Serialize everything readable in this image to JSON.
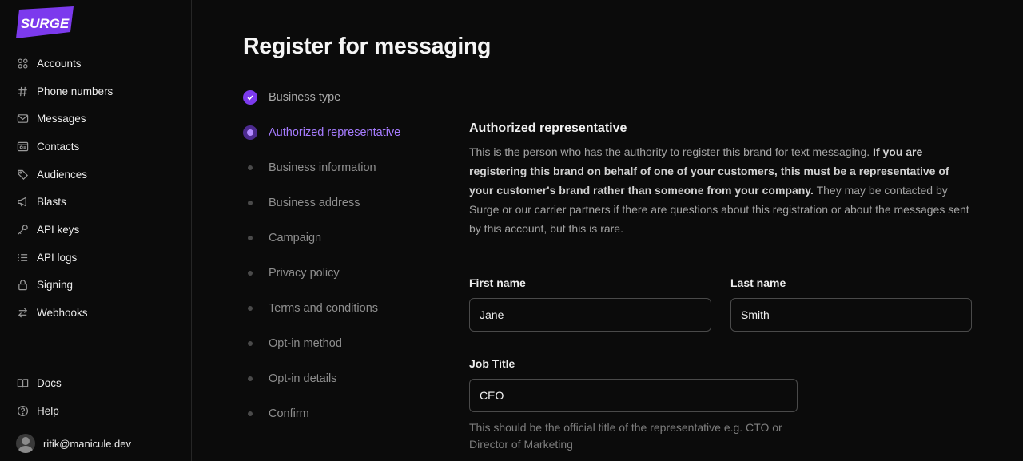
{
  "brand": {
    "name": "SURGE",
    "color": "#7c3aed"
  },
  "sidebar": {
    "items": [
      {
        "label": "Accounts",
        "icon": "accounts-icon"
      },
      {
        "label": "Phone numbers",
        "icon": "hash-icon"
      },
      {
        "label": "Messages",
        "icon": "mail-icon"
      },
      {
        "label": "Contacts",
        "icon": "contact-card-icon"
      },
      {
        "label": "Audiences",
        "icon": "tag-icon"
      },
      {
        "label": "Blasts",
        "icon": "megaphone-icon"
      },
      {
        "label": "API keys",
        "icon": "key-icon"
      },
      {
        "label": "API logs",
        "icon": "list-icon"
      },
      {
        "label": "Signing",
        "icon": "lock-icon"
      },
      {
        "label": "Webhooks",
        "icon": "arrows-icon"
      }
    ],
    "bottom": [
      {
        "label": "Docs",
        "icon": "book-icon"
      },
      {
        "label": "Help",
        "icon": "help-icon"
      }
    ],
    "user": {
      "email": "ritik@manicule.dev"
    }
  },
  "page": {
    "title": "Register for messaging"
  },
  "steps": [
    {
      "label": "Business type",
      "state": "completed"
    },
    {
      "label": "Authorized representative",
      "state": "current"
    },
    {
      "label": "Business information",
      "state": "pending"
    },
    {
      "label": "Business address",
      "state": "pending"
    },
    {
      "label": "Campaign",
      "state": "pending"
    },
    {
      "label": "Privacy policy",
      "state": "pending"
    },
    {
      "label": "Terms and conditions",
      "state": "pending"
    },
    {
      "label": "Opt-in method",
      "state": "pending"
    },
    {
      "label": "Opt-in details",
      "state": "pending"
    },
    {
      "label": "Confirm",
      "state": "pending"
    }
  ],
  "form": {
    "title": "Authorized representative",
    "desc_start": "This is the person who has the authority to register this brand for text messaging. ",
    "desc_bold": "If you are registering this brand on behalf of one of your customers, this must be a representative of your customer's brand rather than someone from your company.",
    "desc_end": " They may be contacted by Surge or our carrier partners if there are questions about this registration or about the messages sent by this account, but this is rare.",
    "first_name": {
      "label": "First name",
      "value": "Jane"
    },
    "last_name": {
      "label": "Last name",
      "value": "Smith"
    },
    "job_title": {
      "label": "Job Title",
      "value": "CEO",
      "hint": "This should be the official title of the representative e.g. CTO or Director of Marketing"
    }
  }
}
